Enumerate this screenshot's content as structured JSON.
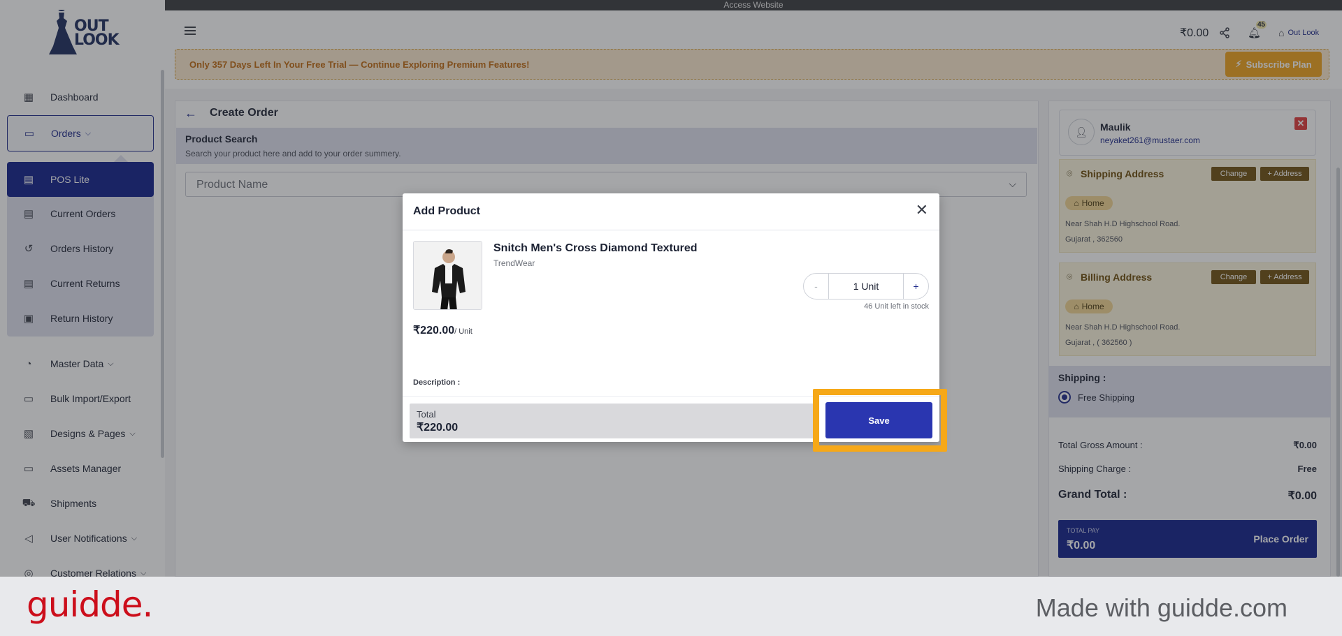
{
  "access_bar": {
    "label": "Access Website"
  },
  "brand": {
    "logo_text": "OUT LOOK"
  },
  "sidebar": {
    "items": [
      {
        "label": "Dashboard",
        "icon": "dashboard-icon"
      },
      {
        "label": "Orders",
        "icon": "monitor-icon"
      },
      {
        "label": "POS Lite",
        "icon": "receipt-icon"
      },
      {
        "label": "Current Orders",
        "icon": "list-icon"
      },
      {
        "label": "Orders History",
        "icon": "history-icon"
      },
      {
        "label": "Current Returns",
        "icon": "list-icon"
      },
      {
        "label": "Return History",
        "icon": "clipboard-icon"
      },
      {
        "label": "Master Data",
        "icon": "gauge-icon"
      },
      {
        "label": "Bulk Import/Export",
        "icon": "folder-icon"
      },
      {
        "label": "Designs & Pages",
        "icon": "design-icon"
      },
      {
        "label": "Assets Manager",
        "icon": "folder-icon"
      },
      {
        "label": "Shipments",
        "icon": "truck-icon"
      },
      {
        "label": "User Notifications",
        "icon": "megaphone-icon"
      },
      {
        "label": "Customer Relations",
        "icon": "handshake-icon"
      }
    ]
  },
  "header": {
    "balance": "₹0.00",
    "notification_count": "45",
    "store_name": "Out Look"
  },
  "trial_banner": {
    "text": "Only 357 Days Left In Your Free Trial — Continue Exploring Premium Features!",
    "button": "Subscribe Plan"
  },
  "create_order": {
    "title": "Create Order",
    "search_title": "Product Search",
    "search_subtitle": "Search your product here and add to your order summery.",
    "product_placeholder": "Product Name"
  },
  "customer": {
    "name": "Maulik",
    "email": "neyaket261@mustaer.com"
  },
  "shipping_address": {
    "title": "Shipping Address",
    "change": "Change",
    "add": "+ Address",
    "tag": "Home",
    "line1": "Near Shah H.D Highschool Road.",
    "line2": "Gujarat , 362560"
  },
  "billing_address": {
    "title": "Billing Address",
    "change": "Change",
    "add": "+ Address",
    "tag": "Home",
    "line1": "Near Shah H.D Highschool Road.",
    "line2": "Gujarat , ( 362560 )"
  },
  "shipping": {
    "title": "Shipping :",
    "option": "Free Shipping"
  },
  "summary": {
    "gross_label": "Total Gross Amount :",
    "gross_value": "₹0.00",
    "charge_label": "Shipping Charge :",
    "charge_value": "Free",
    "grand_label": "Grand Total :",
    "grand_value": "₹0.00",
    "pay_label": "TOTAL PAY",
    "pay_value": "₹0.00",
    "place_order": "Place Order"
  },
  "modal": {
    "title": "Add Product",
    "product_name": "Snitch Men's Cross Diamond Textured",
    "brand": "TrendWear",
    "quantity": "1 Unit",
    "minus": "-",
    "plus": "+",
    "stock": "46 Unit left in stock",
    "price": "₹220.00",
    "unit": "/ Unit",
    "description_label": "Description :",
    "total_label": "Total",
    "total_value": "₹220.00",
    "save": "Save"
  },
  "footer": {
    "logo": "guidde.",
    "made_with": "Made with guidde.com"
  },
  "colors": {
    "primary": "#10208a",
    "accent": "#f0a21a",
    "highlight": "#f6a818",
    "guidde_red": "#cc0e1b"
  }
}
